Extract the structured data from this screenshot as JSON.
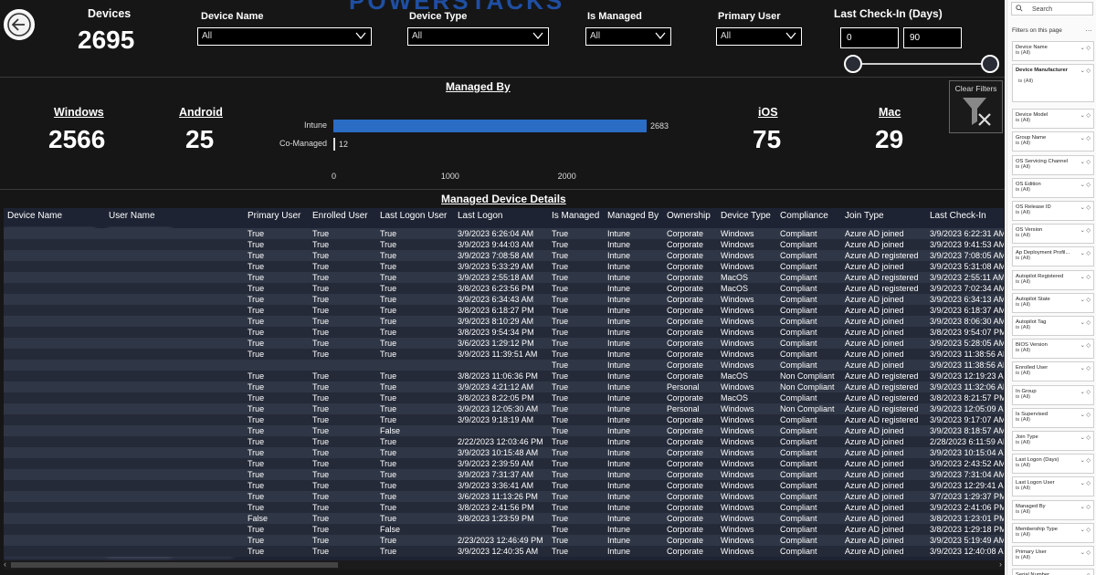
{
  "brand": "POWERSTACKS",
  "kpi": {
    "devices_title": "Devices",
    "devices_value": "2695"
  },
  "slicers": {
    "device_name": {
      "title": "Device Name",
      "value": "All"
    },
    "device_type": {
      "title": "Device Type",
      "value": "All"
    },
    "is_managed": {
      "title": "Is Managed",
      "value": "All"
    },
    "primary_user": {
      "title": "Primary User",
      "value": "All"
    },
    "last_checkin": {
      "title": "Last Check-In (Days)",
      "min": "0",
      "max": "90"
    }
  },
  "os_cards": {
    "windows": {
      "title": "Windows",
      "value": "2566"
    },
    "android": {
      "title": "Android",
      "value": "25"
    },
    "ios": {
      "title": "iOS",
      "value": "75"
    },
    "mac": {
      "title": "Mac",
      "value": "29"
    }
  },
  "managed_by_chart": {
    "title": "Managed By",
    "clear_filters_label": "Clear Filters"
  },
  "chart_data": {
    "type": "bar",
    "orientation": "horizontal",
    "title": "Managed By",
    "categories": [
      "Intune",
      "Co-Managed"
    ],
    "values": [
      2683,
      12
    ],
    "xlim": [
      0,
      2683
    ],
    "ticks": [
      "0",
      "1000",
      "2000"
    ],
    "data_labels": [
      "2683",
      "12"
    ],
    "color": "#2b6cc4"
  },
  "table": {
    "title": "Managed Device Details",
    "columns": [
      "Device Name",
      "User Name",
      "Primary User",
      "Enrolled User",
      "Last Logon User",
      "Last Logon",
      "Is Managed",
      "Managed By",
      "Ownership",
      "Device Type",
      "Compliance",
      "Join Type",
      "Last Check-In"
    ],
    "rows": [
      [
        "True",
        "True",
        "True",
        "3/9/2023 6:26:04 AM",
        "True",
        "Intune",
        "Corporate",
        "Windows",
        "Compliant",
        "Azure AD joined",
        "3/9/2023 6:22:31 AM"
      ],
      [
        "True",
        "True",
        "True",
        "3/9/2023 9:44:03 AM",
        "True",
        "Intune",
        "Corporate",
        "Windows",
        "Compliant",
        "Azure AD joined",
        "3/9/2023 9:41:53 AM"
      ],
      [
        "True",
        "True",
        "True",
        "3/9/2023 7:08:58 AM",
        "True",
        "Intune",
        "Corporate",
        "Windows",
        "Compliant",
        "Azure AD registered",
        "3/9/2023 7:08:05 AM"
      ],
      [
        "True",
        "True",
        "True",
        "3/9/2023 5:33:29 AM",
        "True",
        "Intune",
        "Corporate",
        "Windows",
        "Compliant",
        "Azure AD joined",
        "3/9/2023 5:31:08 AM"
      ],
      [
        "True",
        "True",
        "True",
        "3/9/2023 2:55:18 AM",
        "True",
        "Intune",
        "Corporate",
        "MacOS",
        "Compliant",
        "Azure AD registered",
        "3/9/2023 2:55:11 AM"
      ],
      [
        "True",
        "True",
        "True",
        "3/8/2023 6:23:56 PM",
        "True",
        "Intune",
        "Corporate",
        "MacOS",
        "Compliant",
        "Azure AD registered",
        "3/9/2023 7:02:34 AM"
      ],
      [
        "True",
        "True",
        "True",
        "3/9/2023 6:34:43 AM",
        "True",
        "Intune",
        "Corporate",
        "Windows",
        "Compliant",
        "Azure AD joined",
        "3/9/2023 6:34:13 AM"
      ],
      [
        "True",
        "True",
        "True",
        "3/8/2023 6:18:27 PM",
        "True",
        "Intune",
        "Corporate",
        "Windows",
        "Compliant",
        "Azure AD joined",
        "3/9/2023 6:18:37 AM"
      ],
      [
        "True",
        "True",
        "True",
        "3/9/2023 8:10:29 AM",
        "True",
        "Intune",
        "Corporate",
        "Windows",
        "Compliant",
        "Azure AD joined",
        "3/9/2023 8:06:30 AM"
      ],
      [
        "True",
        "True",
        "True",
        "3/8/2023 9:54:34 PM",
        "True",
        "Intune",
        "Corporate",
        "Windows",
        "Compliant",
        "Azure AD joined",
        "3/8/2023 9:54:07 PM"
      ],
      [
        "True",
        "True",
        "True",
        "3/6/2023 1:29:12 PM",
        "True",
        "Intune",
        "Corporate",
        "Windows",
        "Compliant",
        "Azure AD joined",
        "3/9/2023 5:28:05 AM"
      ],
      [
        "True",
        "True",
        "True",
        "3/9/2023 11:39:51 AM",
        "True",
        "Intune",
        "Corporate",
        "Windows",
        "Compliant",
        "Azure AD joined",
        "3/9/2023 11:38:56 AM"
      ],
      [
        "",
        "",
        "",
        "",
        "True",
        "Intune",
        "Corporate",
        "Windows",
        "Compliant",
        "Azure AD joined",
        "3/9/2023 11:38:56 AM"
      ],
      [
        "True",
        "True",
        "True",
        "3/8/2023 11:06:36 PM",
        "True",
        "Intune",
        "Corporate",
        "MacOS",
        "Non Compliant",
        "Azure AD registered",
        "3/9/2023 12:19:23 AM"
      ],
      [
        "True",
        "True",
        "True",
        "3/9/2023 4:21:12 AM",
        "True",
        "Intune",
        "Personal",
        "Windows",
        "Non Compliant",
        "Azure AD registered",
        "3/9/2023 11:32:06 AM"
      ],
      [
        "True",
        "True",
        "True",
        "3/8/2023 8:22:05 PM",
        "True",
        "Intune",
        "Corporate",
        "MacOS",
        "Compliant",
        "Azure AD registered",
        "3/8/2023 8:21:57 PM"
      ],
      [
        "True",
        "True",
        "True",
        "3/9/2023 12:05:30 AM",
        "True",
        "Intune",
        "Personal",
        "Windows",
        "Non Compliant",
        "Azure AD registered",
        "3/9/2023 12:05:09 AM"
      ],
      [
        "True",
        "True",
        "True",
        "3/9/2023 9:18:19 AM",
        "True",
        "Intune",
        "Corporate",
        "Windows",
        "Compliant",
        "Azure AD registered",
        "3/9/2023 9:17:07 AM"
      ],
      [
        "True",
        "True",
        "False",
        "",
        "True",
        "Intune",
        "Corporate",
        "Windows",
        "Compliant",
        "Azure AD joined",
        "3/9/2023 8:18:57 AM"
      ],
      [
        "True",
        "True",
        "True",
        "2/22/2023 12:03:46 PM",
        "True",
        "Intune",
        "Corporate",
        "Windows",
        "Compliant",
        "Azure AD joined",
        "2/28/2023 6:11:59 AM"
      ],
      [
        "True",
        "True",
        "True",
        "3/9/2023 10:15:48 AM",
        "True",
        "Intune",
        "Corporate",
        "Windows",
        "Compliant",
        "Azure AD joined",
        "3/9/2023 10:15:04 AM"
      ],
      [
        "True",
        "True",
        "True",
        "3/9/2023 2:39:59 AM",
        "True",
        "Intune",
        "Corporate",
        "Windows",
        "Compliant",
        "Azure AD joined",
        "3/9/2023 2:43:52 AM"
      ],
      [
        "True",
        "True",
        "True",
        "3/9/2023 7:31:37 AM",
        "True",
        "Intune",
        "Corporate",
        "Windows",
        "Compliant",
        "Azure AD joined",
        "3/9/2023 7:31:04 AM"
      ],
      [
        "True",
        "True",
        "True",
        "3/9/2023 3:36:41 AM",
        "True",
        "Intune",
        "Corporate",
        "Windows",
        "Compliant",
        "Azure AD joined",
        "3/9/2023 12:29:41 AM"
      ],
      [
        "True",
        "True",
        "True",
        "3/6/2023 11:13:26 PM",
        "True",
        "Intune",
        "Corporate",
        "Windows",
        "Compliant",
        "Azure AD joined",
        "3/7/2023 1:29:37 PM"
      ],
      [
        "True",
        "True",
        "True",
        "3/8/2023 2:41:56 PM",
        "True",
        "Intune",
        "Corporate",
        "Windows",
        "Compliant",
        "Azure AD joined",
        "3/9/2023 2:41:06 PM"
      ],
      [
        "False",
        "True",
        "True",
        "3/8/2023 1:23:59 PM",
        "True",
        "Intune",
        "Corporate",
        "Windows",
        "Compliant",
        "Azure AD joined",
        "3/8/2023 1:23:01 PM"
      ],
      [
        "True",
        "True",
        "False",
        "",
        "True",
        "Intune",
        "Corporate",
        "Windows",
        "Compliant",
        "Azure AD joined",
        "3/8/2023 1:29:18 PM"
      ],
      [
        "True",
        "True",
        "True",
        "2/23/2023 12:46:49 PM",
        "True",
        "Intune",
        "Corporate",
        "Windows",
        "Compliant",
        "Azure AD joined",
        "3/9/2023 5:19:49 AM"
      ],
      [
        "True",
        "True",
        "True",
        "3/9/2023 12:40:35 AM",
        "True",
        "Intune",
        "Corporate",
        "Windows",
        "Compliant",
        "Azure AD joined",
        "3/9/2023 12:40:08 AM"
      ]
    ]
  },
  "filter_pane": {
    "search_placeholder": "Search",
    "title": "Filters on this page",
    "cards": [
      {
        "name": "Device Name",
        "value": "is (All)"
      },
      {
        "name": "Device Manufacturer",
        "value": "is (All)"
      },
      {
        "name": "Device Model",
        "value": "is (All)"
      },
      {
        "name": "Group Name",
        "value": "is (All)"
      },
      {
        "name": "OS Servicing Channel",
        "value": "is (All)"
      },
      {
        "name": "OS Edition",
        "value": "is (All)"
      },
      {
        "name": "OS Release ID",
        "value": "is (All)"
      },
      {
        "name": "OS Version",
        "value": "is (All)"
      },
      {
        "name": "Ap Deployment Profil...",
        "value": "is (All)"
      },
      {
        "name": "Autopilot Registered",
        "value": "is (All)"
      },
      {
        "name": "Autopilot State",
        "value": "is (All)"
      },
      {
        "name": "Autopilot Tag",
        "value": "is (All)"
      },
      {
        "name": "BIOS Version",
        "value": "is (All)"
      },
      {
        "name": "Enrolled User",
        "value": "is (All)"
      },
      {
        "name": "In Group",
        "value": "is (All)"
      },
      {
        "name": "Is Supervised",
        "value": "is (All)"
      },
      {
        "name": "Join Type",
        "value": "is (All)"
      },
      {
        "name": "Last Logon (Days)",
        "value": "is (All)"
      },
      {
        "name": "Last Logon User",
        "value": "is (All)"
      },
      {
        "name": "Managed By",
        "value": "is (All)"
      },
      {
        "name": "Membership Type",
        "value": "is (All)"
      },
      {
        "name": "Primary User",
        "value": "is (All)"
      },
      {
        "name": "Serial Number",
        "value": ""
      }
    ]
  }
}
